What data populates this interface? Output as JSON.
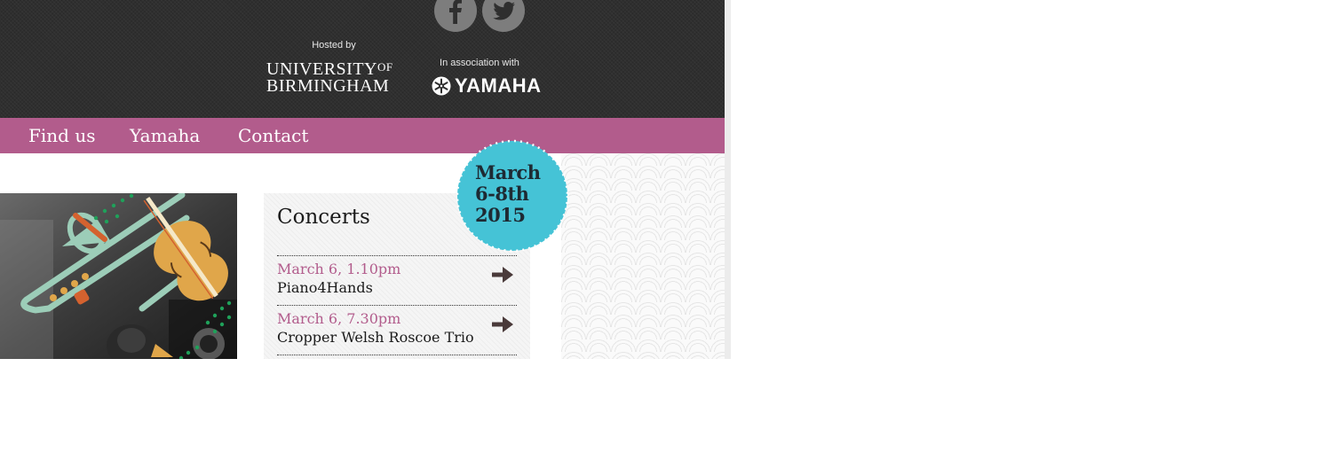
{
  "header": {
    "social": {
      "facebook_icon": "facebook-icon",
      "twitter_icon": "twitter-icon"
    },
    "hosted_by": "Hosted by",
    "university": {
      "line1": "UNIVERSITY",
      "of": "OF",
      "line2": "BIRMINGHAM"
    },
    "association": "In association with",
    "sponsor": "YAMAHA",
    "background_color": "#2f2f2f"
  },
  "nav": {
    "background_color": "#b25c8c",
    "items": [
      {
        "label": "Find us"
      },
      {
        "label": "Yamaha"
      },
      {
        "label": "Contact"
      }
    ]
  },
  "badge": {
    "lines": [
      "March",
      "6-8th",
      "2015"
    ],
    "color": "#45c3d6"
  },
  "concerts": {
    "title": "Concerts",
    "items": [
      {
        "date": "March 6, 1.10pm",
        "name": "Piano4Hands"
      },
      {
        "date": "March 6, 7.30pm",
        "name": "Cropper Welsh Roscoe Trio"
      }
    ]
  },
  "colors": {
    "accent": "#b25c8c",
    "badge": "#45c3d6"
  }
}
